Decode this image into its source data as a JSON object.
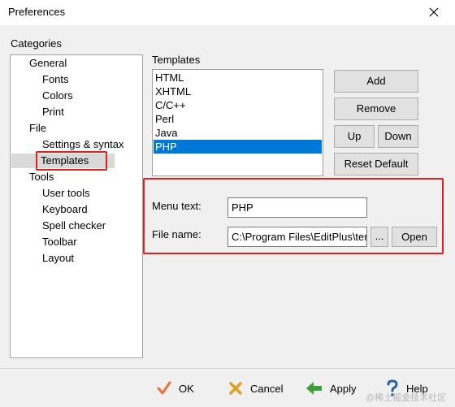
{
  "window": {
    "title": "Preferences"
  },
  "categories": {
    "label": "Categories",
    "items": [
      {
        "label": "General",
        "level": 0
      },
      {
        "label": "Fonts",
        "level": 1
      },
      {
        "label": "Colors",
        "level": 1
      },
      {
        "label": "Print",
        "level": 1
      },
      {
        "label": "File",
        "level": 0
      },
      {
        "label": "Settings & syntax",
        "level": 1
      },
      {
        "label": "Templates",
        "level": 1,
        "selected": true
      },
      {
        "label": "Tools",
        "level": 0
      },
      {
        "label": "User tools",
        "level": 1
      },
      {
        "label": "Keyboard",
        "level": 1
      },
      {
        "label": "Spell checker",
        "level": 1
      },
      {
        "label": "Toolbar",
        "level": 1
      },
      {
        "label": "Layout",
        "level": 1
      }
    ]
  },
  "templates": {
    "label": "Templates",
    "items": [
      "HTML",
      "XHTML",
      "C/C++",
      "Perl",
      "Java",
      "PHP"
    ],
    "selected": "PHP",
    "buttons": {
      "add": "Add",
      "remove": "Remove",
      "up": "Up",
      "down": "Down",
      "reset_default": "Reset Default"
    }
  },
  "details": {
    "menu_text_label": "Menu text:",
    "menu_text_value": "PHP",
    "file_name_label": "File name:",
    "file_name_value": "C:\\Program Files\\EditPlus\\template.php",
    "browse_label": "...",
    "open_label": "Open"
  },
  "footer": {
    "ok": "OK",
    "cancel": "Cancel",
    "apply": "Apply",
    "help": "Help"
  },
  "watermark": "@稀土掘金技术社区",
  "colors": {
    "selection": "#0078d7",
    "highlight_box": "#e02020",
    "ok_check": "#e8743b",
    "cancel_x": "#e0a020",
    "apply_arrow": "#3aa03a",
    "help_mark": "#2a5db0"
  }
}
